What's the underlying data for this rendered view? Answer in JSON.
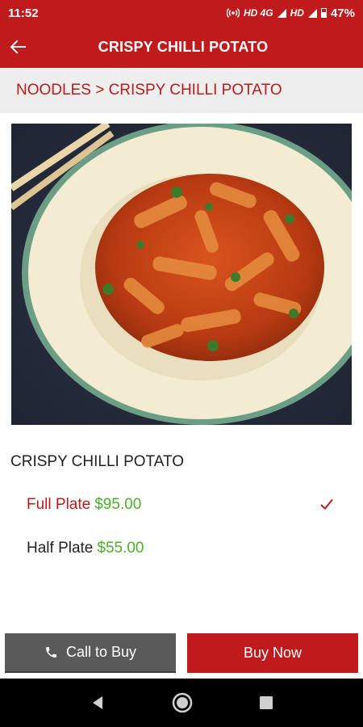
{
  "status_bar": {
    "time": "11:52",
    "network_1": "HD 4G",
    "network_2": "HD",
    "battery": "47%"
  },
  "toolbar": {
    "title": "CRISPY CHILLI POTATO",
    "back_icon": "arrow-left-icon"
  },
  "breadcrumb": {
    "text": "NOODLES > CRISPY CHILLI POTATO"
  },
  "product": {
    "name": "CRISPY CHILLI POTATO",
    "image_icon": "food-photo",
    "options": [
      {
        "label": "Full Plate",
        "price": "$95.00",
        "selected": true
      },
      {
        "label": "Half Plate",
        "price": "$55.00",
        "selected": false
      }
    ]
  },
  "actions": {
    "call_label": "Call to Buy",
    "buy_label": "Buy Now"
  },
  "colors": {
    "brand_red": "#c01a1c",
    "price_green": "#4caf28",
    "call_gray": "#5a5a5a"
  }
}
